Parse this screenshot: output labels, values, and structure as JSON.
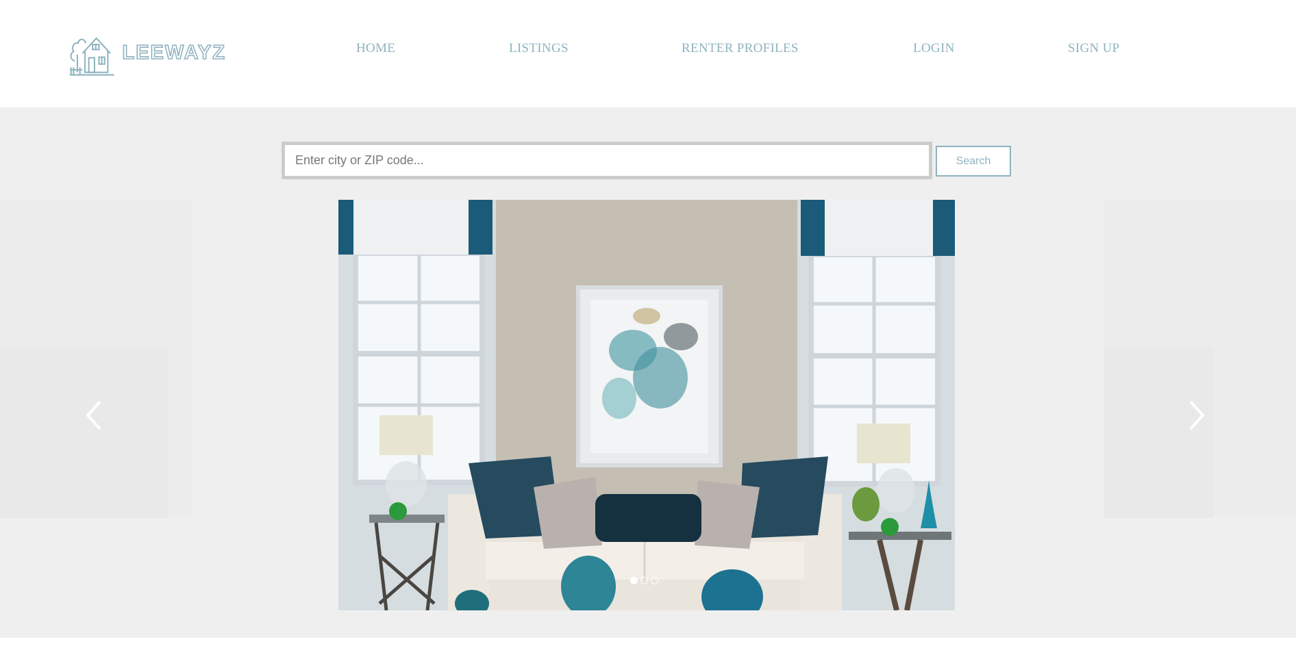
{
  "brand": {
    "name": "LEEWAYZ",
    "icon": "house-tree-icon"
  },
  "nav": {
    "home": "HOME",
    "listings": "LISTINGS",
    "renter_profiles": "RENTER PROFILES",
    "login": "LOGIN",
    "signup": "SIGN UP"
  },
  "search": {
    "placeholder": "Enter city or ZIP code...",
    "value": "",
    "button_label": "Search"
  },
  "carousel": {
    "prev_icon": "chevron-left-icon",
    "next_icon": "chevron-right-icon",
    "slide_image": "living-room-sofa-image",
    "slide_count": 3,
    "active_index": 0
  },
  "colors": {
    "accent": "#8fb3c0",
    "hero_background": "#efefef",
    "header_background": "#ffffff"
  }
}
